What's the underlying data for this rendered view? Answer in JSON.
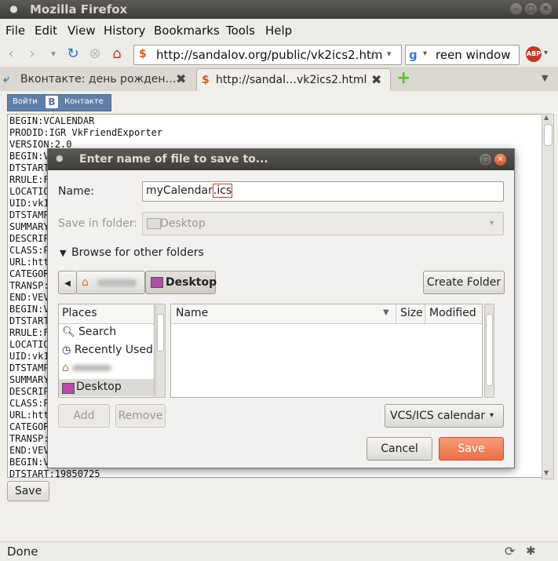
{
  "window": {
    "title": "Mozilla Firefox"
  },
  "menubar": {
    "items": [
      "File",
      "Edit",
      "View",
      "History",
      "Bookmarks",
      "Tools",
      "Help"
    ]
  },
  "navbar": {
    "url": "http://sandalov.org/public/vk2ics2.htm",
    "search_text": "reen window"
  },
  "tabs": [
    {
      "label": "Вконтакте: день рожден…"
    },
    {
      "label": "http://sandal…vk2ics2.html"
    }
  ],
  "page": {
    "vk_button_login": "Войти",
    "vk_button_logo": "В",
    "vk_button_brand": "Контакте",
    "save_button": "Save",
    "ics_lines": [
      "BEGIN:VCALENDAR",
      "PRODID:IGR VkFriendExporter",
      "VERSION:2.0",
      "BEGIN:V",
      "DTSTART",
      "RRULE:F",
      "LOCATIO",
      "UID:vk1",
      "DTSTAMP",
      "SUMMARY",
      "DESCRIP",
      "CLASS:P",
      "URL:htt",
      "CATEGOR",
      "TRANSP:",
      "END:VEV",
      "BEGIN:V",
      "DTSTART",
      "RRULE:F",
      "LOCATIO",
      "UID:vk1",
      "DTSTAMP",
      "SUMMARY",
      "DESCRIP",
      "CLASS:P",
      "URL:htt",
      "CATEGOR",
      "TRANSP:",
      "END:VEV",
      "BEGIN:V",
      "DTSTART:19850725"
    ]
  },
  "status": {
    "text": "Done"
  },
  "dialog": {
    "title": "Enter name of file to save to...",
    "name_label": "Name:",
    "name_base": "myCalendar",
    "name_ext": ".ics",
    "folder_label": "Save in folder:",
    "folder_value": "Desktop",
    "browse_label": "Browse for other folders",
    "path_current": "Desktop",
    "create_folder": "Create Folder",
    "places_header": "Places",
    "places": [
      "Search",
      "Recently Used",
      "Desktop"
    ],
    "columns": {
      "name": "Name",
      "size": "Size",
      "modified": "Modified"
    },
    "add": "Add",
    "remove": "Remove",
    "filter": "VCS/ICS calendar",
    "cancel": "Cancel",
    "save": "Save"
  },
  "colors": {
    "accent": "#ec6f44",
    "vk_blue": "#5f7fa8",
    "titlebar": "#3e3d39"
  }
}
